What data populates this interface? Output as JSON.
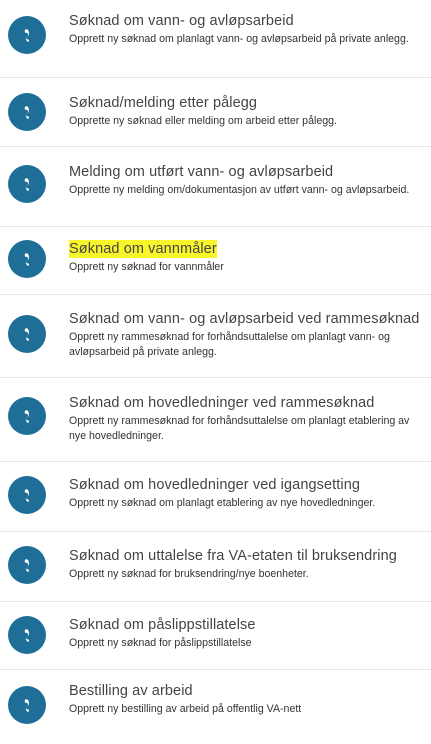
{
  "accent_color": "#1f6e97",
  "highlight_color": "#f8f62b",
  "items": [
    {
      "icon": "phone-icon",
      "title": "Søknad om vann- og avløpsarbeid",
      "description": "Opprett ny søknad om planlagt vann- og avløpsarbeid på private anlegg.",
      "highlighted": false
    },
    {
      "icon": "phone-icon",
      "title": "Søknad/melding etter pålegg",
      "description": "Opprette ny søknad eller melding om arbeid etter pålegg.",
      "highlighted": false
    },
    {
      "icon": "phone-icon",
      "title": "Melding om utført vann- og avløpsarbeid",
      "description": "Opprette ny melding om/dokumentasjon av utført vann- og avløpsarbeid.",
      "highlighted": false
    },
    {
      "icon": "phone-icon",
      "title": "Søknad om vannmåler",
      "description": "Opprett ny søknad for vannmåler",
      "highlighted": true
    },
    {
      "icon": "phone-icon",
      "title": "Søknad om vann- og avløpsarbeid ved rammesøknad",
      "description": "Opprett ny rammesøknad for forhåndsuttalelse om planlagt vann- og avløpsarbeid på private anlegg.",
      "highlighted": false
    },
    {
      "icon": "phone-icon",
      "title": "Søknad om hovedledninger ved rammesøknad",
      "description": "Opprett ny rammesøknad for forhåndsuttalelse om planlagt etablering av nye hovedledninger.",
      "highlighted": false
    },
    {
      "icon": "phone-icon",
      "title": "Søknad om hovedledninger ved igangsetting",
      "description": "Opprett ny søknad om planlagt etablering av nye hovedledninger.",
      "highlighted": false
    },
    {
      "icon": "phone-icon",
      "title": "Søknad om uttalelse fra VA-etaten til bruksendring",
      "description": "Opprett ny søknad for bruksendring/nye boenheter.",
      "highlighted": false
    },
    {
      "icon": "phone-icon",
      "title": "Søknad om påslippstillatelse",
      "description": "Opprett ny søknad for påslippstillatelse",
      "highlighted": false
    },
    {
      "icon": "phone-icon",
      "title": "Bestilling av arbeid",
      "description": "Opprett ny bestilling av arbeid på offentlig VA-nett",
      "highlighted": false
    }
  ]
}
